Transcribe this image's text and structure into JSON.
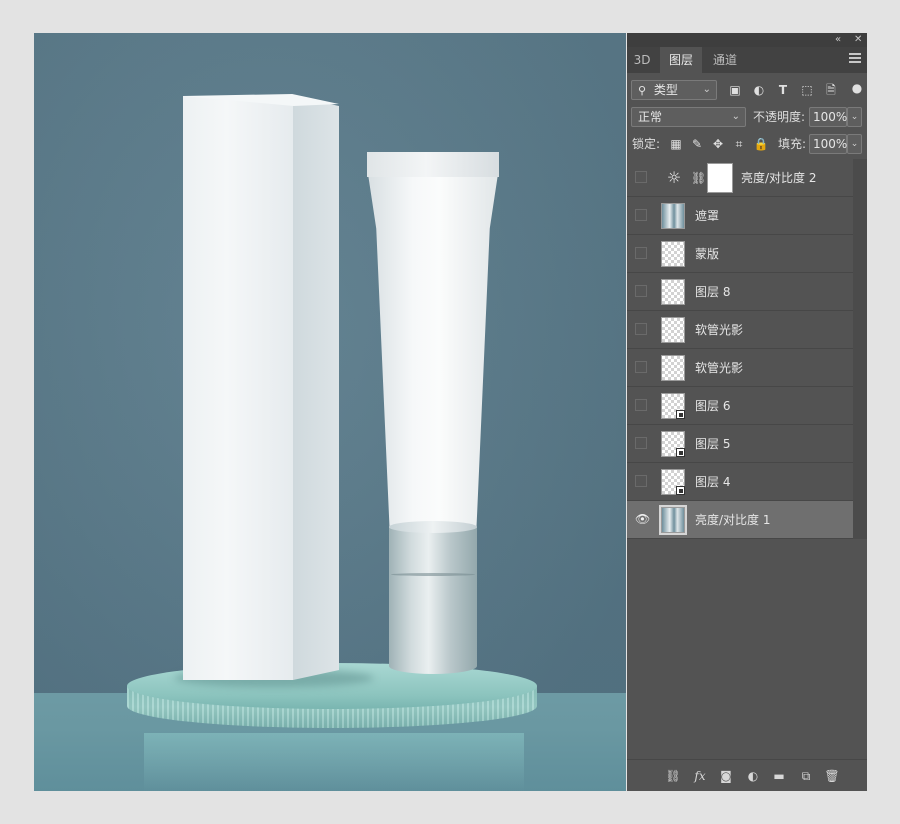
{
  "panel": {
    "collapse_icon": "double-chevron-icon",
    "close_icon": "close-icon",
    "tabs": [
      {
        "label": "3D"
      },
      {
        "label": "图层"
      },
      {
        "label": "通道"
      }
    ],
    "filter": {
      "label": "类型",
      "icon": "search-icon"
    },
    "filter_icons": [
      "image-filter-icon",
      "adjustment-filter-icon",
      "type-filter-icon",
      "shape-filter-icon",
      "smart-object-filter-icon",
      "filter-toggle-icon"
    ],
    "blend_mode": "正常",
    "opacity_label": "不透明度:",
    "opacity_value": "100%",
    "lock_label": "锁定:",
    "fill_label": "填充:",
    "fill_value": "100%",
    "layers": [
      {
        "name": "亮度/对比度 2",
        "type": "adjustment",
        "visible": false
      },
      {
        "name": "遮罩",
        "type": "photo",
        "visible": false
      },
      {
        "name": "蒙版",
        "type": "transparent",
        "visible": false
      },
      {
        "name": "图层 8",
        "type": "transparent",
        "visible": false
      },
      {
        "name": "软管光影",
        "type": "transparent",
        "visible": false
      },
      {
        "name": "软管光影",
        "type": "transparent",
        "visible": false
      },
      {
        "name": "图层 6",
        "type": "smart",
        "visible": false
      },
      {
        "name": "图层 5",
        "type": "smart",
        "visible": false
      },
      {
        "name": "图层 4",
        "type": "smart",
        "visible": false
      },
      {
        "name": "亮度/对比度 1",
        "type": "photo",
        "visible": true,
        "selected": true
      }
    ],
    "bottom_icons": [
      "link-icon",
      "fx-icon",
      "mask-icon",
      "adjustment-icon",
      "folder-icon",
      "new-layer-icon",
      "trash-icon"
    ]
  }
}
